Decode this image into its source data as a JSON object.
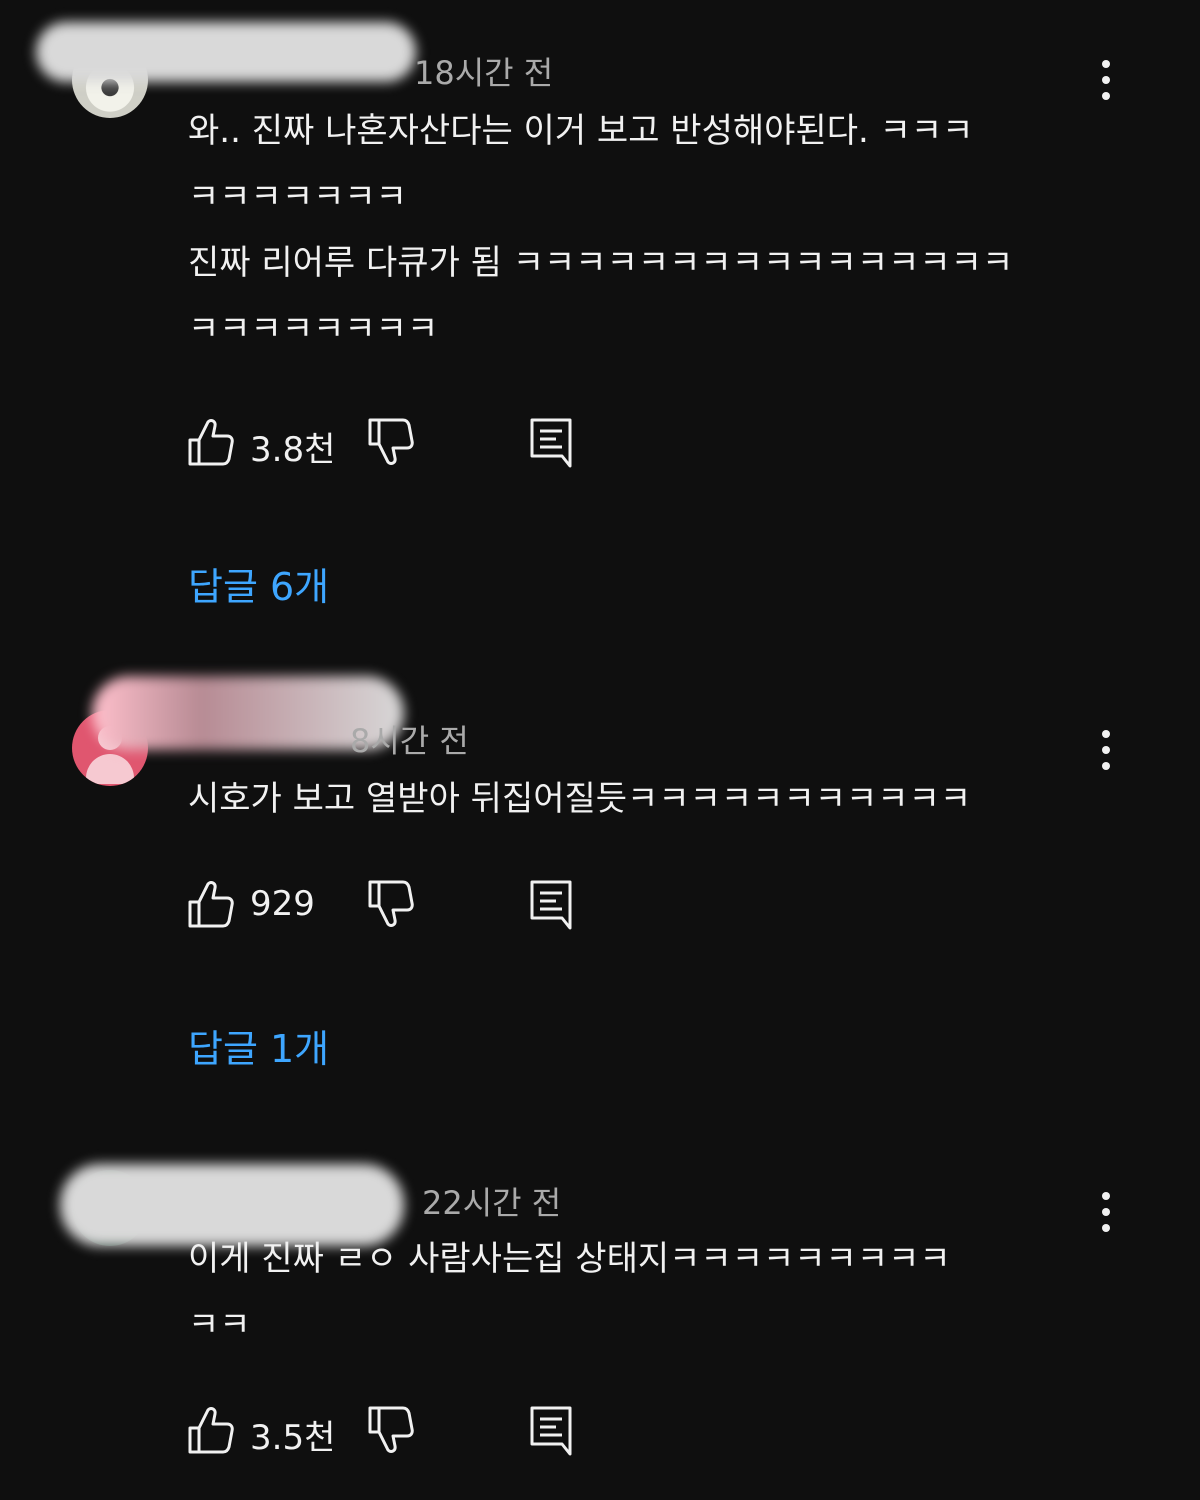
{
  "comments": [
    {
      "timestamp": "18시간 전",
      "text": "와.. 진짜 나혼자산다는 이거 보고 반성해야된다. ㅋㅋㅋ\nㅋㅋㅋㅋㅋㅋㅋ\n진짜 리어루 다큐가 됨 ㅋㅋㅋㅋㅋㅋㅋㅋㅋㅋㅋㅋㅋㅋㅋㅋ\nㅋㅋㅋㅋㅋㅋㅋㅋ",
      "likes": "3.8천",
      "replies": "답글 6개",
      "avatar_icon": "photo-avatar"
    },
    {
      "timestamp": "8시간 전",
      "text": "시호가 보고 열받아 뒤집어질듯ㅋㅋㅋㅋㅋㅋㅋㅋㅋㅋㅋ",
      "likes": "929",
      "replies": "답글 1개",
      "avatar_icon": "default-person-avatar"
    },
    {
      "timestamp": "22시간 전",
      "text": "이게 진짜 ㄹㅇ 사람사는집 상태지ㅋㅋㅋㅋㅋㅋㅋㅋㅋ\nㅋㅋ",
      "likes": "3.5천",
      "avatar_icon": "photo-avatar"
    }
  ],
  "icons": {
    "like": "thumbs-up-icon",
    "dislike": "thumbs-down-icon",
    "reply": "reply-icon",
    "menu": "more-vert-icon"
  },
  "colors": {
    "background": "#0f0f0f",
    "text": "#f1f1f1",
    "secondary_text": "#aaaaaa",
    "link": "#3ea6ff",
    "default_avatar": "#e0566f"
  }
}
